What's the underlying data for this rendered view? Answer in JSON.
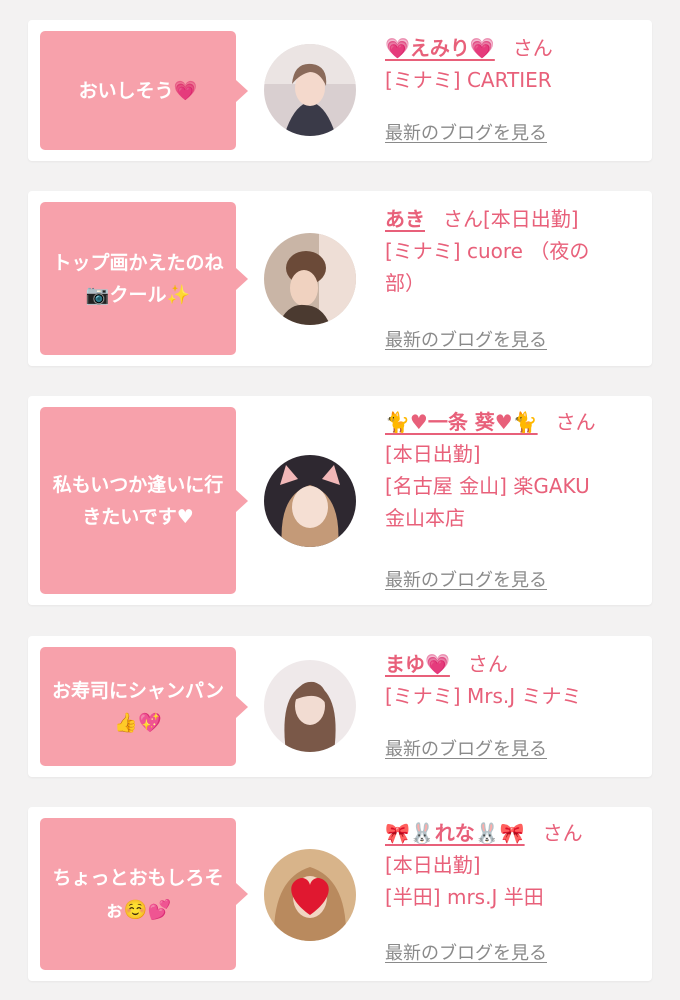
{
  "entries": [
    {
      "comment": "おいしそう💗",
      "name": "💗えみり💗",
      "san": "さん",
      "lines": [
        "[ミナミ] CARTIER"
      ],
      "link": "最新のブログを見る"
    },
    {
      "comment": "トップ画かえたのね📷クール✨",
      "name": "あき",
      "san": "さん[本日出勤]",
      "lines": [
        "[ミナミ] cuore （夜の",
        "部）"
      ],
      "link": "最新のブログを見る"
    },
    {
      "comment": "私もいつか逢いに行きたいです♥",
      "name": "🐈♥一条 葵♥🐈",
      "san": "さん",
      "lines": [
        "[本日出勤]",
        "[名古屋 金山] 楽GAKU",
        "金山本店"
      ],
      "link": "最新のブログを見る"
    },
    {
      "comment": "お寿司にシャンパン👍💖",
      "name": "まゆ💗",
      "san": "さん",
      "lines": [
        "[ミナミ] Mrs.J ミナミ"
      ],
      "link": "最新のブログを見る"
    },
    {
      "comment": "ちょっとおもしろそぉ☺️💕",
      "name": "🎀🐰れな🐰🎀",
      "san": "さん",
      "lines": [
        "[本日出勤]",
        "[半田] mrs.J 半田"
      ],
      "link": "最新のブログを見る"
    }
  ],
  "colors": {
    "bubble": "#f7a1ab",
    "text": "#e8607a",
    "link": "#8a8a8a",
    "background": "#f3f2f2"
  }
}
